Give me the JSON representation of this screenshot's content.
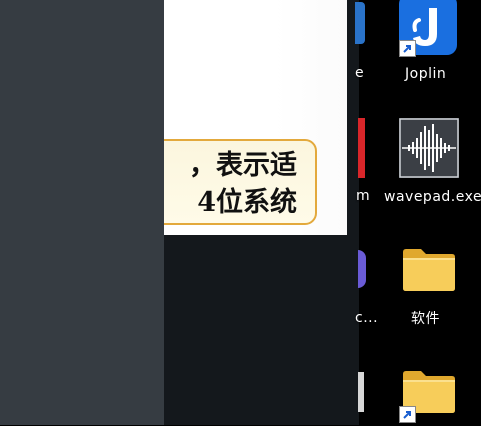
{
  "document": {
    "callout_line1": "，表示适",
    "callout_line2": "4位系统"
  },
  "desktop": {
    "icons": [
      {
        "name": "joplin",
        "label": "Joplin",
        "accent": "#1a6fe0"
      },
      {
        "name": "wavepad",
        "label": "wavepad.exe"
      },
      {
        "name": "folder-software",
        "label": "软件",
        "accent": "#f2c14b"
      },
      {
        "name": "folder-shortcut",
        "label": "",
        "accent": "#f2c14b"
      }
    ],
    "partial_labels": {
      "row1": "e",
      "row2": "m",
      "row3": "c..."
    }
  }
}
